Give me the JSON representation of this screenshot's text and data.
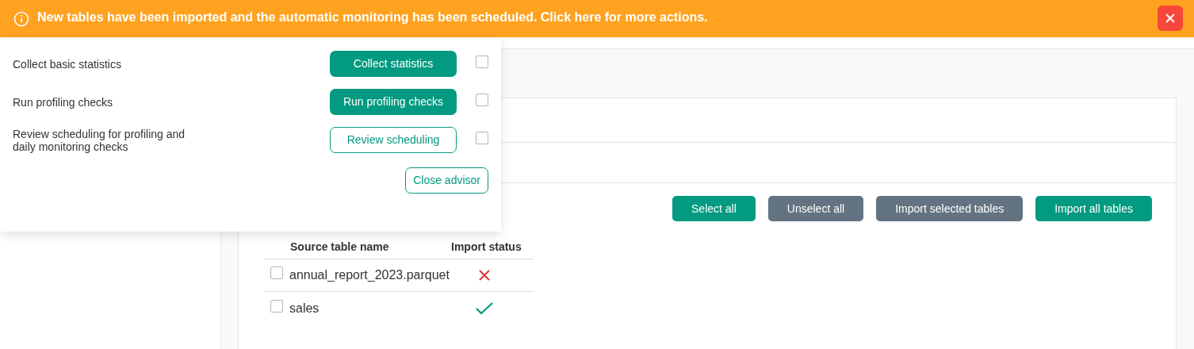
{
  "banner": {
    "message": "New tables have been imported and the automatic monitoring has been scheduled. Click here for more actions."
  },
  "advisor": {
    "items": [
      {
        "description": "Collect basic statistics",
        "action": "Collect statistics",
        "kind": "solid",
        "checked": false
      },
      {
        "description": "Run profiling checks",
        "action": "Run profiling checks",
        "kind": "solid",
        "checked": false
      },
      {
        "description": "Review scheduling for profiling and daily monitoring checks",
        "action": "Review scheduling",
        "kind": "outline",
        "checked": false
      }
    ],
    "close_button": "Close advisor"
  },
  "actions": [
    {
      "label": "Select all",
      "kind": "primary"
    },
    {
      "label": "Unselect all",
      "kind": "secondary"
    },
    {
      "label": "Import selected tables",
      "kind": "secondary"
    },
    {
      "label": "Import all tables",
      "kind": "primary"
    }
  ],
  "table": {
    "columns": [
      "Source table name",
      "Import status"
    ],
    "rows": [
      {
        "name": "annual_report_2023.parquet",
        "kind": "failed",
        "checked": false
      },
      {
        "name": "sales",
        "kind": "imported",
        "checked": false
      }
    ]
  }
}
